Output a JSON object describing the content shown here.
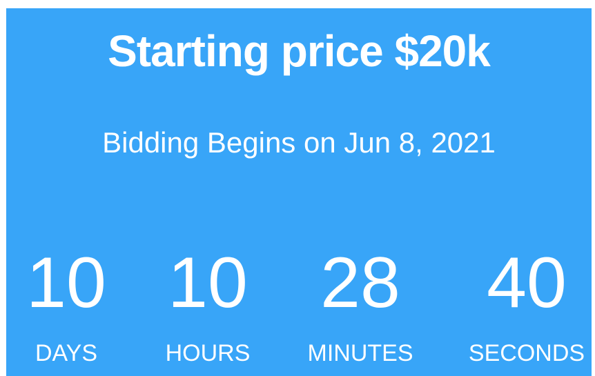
{
  "header": {
    "title": "Starting price $20k",
    "subtitle": "Bidding Begins on Jun 8, 2021"
  },
  "countdown": [
    {
      "value": "10",
      "label": "DAYS"
    },
    {
      "value": "10",
      "label": "HOURS"
    },
    {
      "value": "28",
      "label": "MINUTES"
    },
    {
      "value": "40",
      "label": "SECONDS"
    }
  ],
  "colors": {
    "background": "#38a5f8",
    "text": "#ffffff"
  }
}
